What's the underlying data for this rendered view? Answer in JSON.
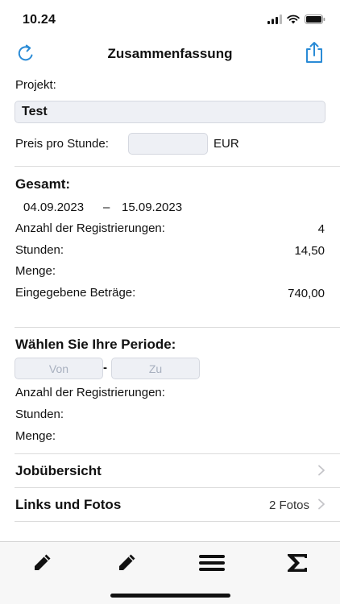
{
  "status_bar": {
    "time": "10.24"
  },
  "nav": {
    "title": "Zusammenfassung"
  },
  "project": {
    "label": "Projekt:",
    "value": "Test"
  },
  "price": {
    "label": "Preis pro Stunde:",
    "value": "",
    "currency": "EUR"
  },
  "summary": {
    "title": "Gesamt:",
    "date_from": "04.09.2023",
    "date_separator": "–",
    "date_to": "15.09.2023",
    "registrations_label": "Anzahl der Registrierungen:",
    "registrations_value": "4",
    "hours_label": "Stunden:",
    "hours_value": "14,50",
    "quantity_label": "Menge:",
    "amounts_label": "Eingegebene Beträge:",
    "amounts_value": "740,00"
  },
  "period": {
    "title": "Wählen Sie Ihre Periode:",
    "from_placeholder": "Von",
    "separator": "-",
    "to_placeholder": "Zu",
    "registrations_label": "Anzahl der Registrierungen:",
    "hours_label": "Stunden:",
    "quantity_label": "Menge:"
  },
  "rows": {
    "jobs": {
      "label": "Jobübersicht"
    },
    "links": {
      "label": "Links und Fotos",
      "detail": "2 Fotos"
    }
  },
  "tabs": [
    {
      "icon": "pencil-icon"
    },
    {
      "icon": "pencil-icon"
    },
    {
      "icon": "menu-icon"
    },
    {
      "icon": "sigma-icon"
    }
  ],
  "colors": {
    "accent": "#2a8bd6",
    "field_bg": "#eef0f5",
    "placeholder": "#a8b0bf"
  }
}
